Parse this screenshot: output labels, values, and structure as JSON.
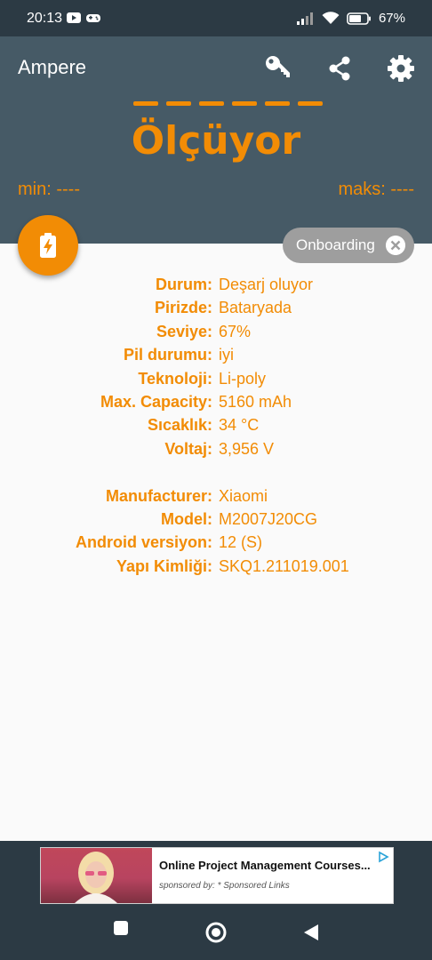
{
  "status_bar": {
    "time": "20:13",
    "battery_percent": "67%"
  },
  "app": {
    "title": "Ampere"
  },
  "header": {
    "measuring_text": "Ölçüyor",
    "min_label": "min: ----",
    "max_label": "maks: ----",
    "accent_color": "#f28c05",
    "background_color": "#465a66"
  },
  "onboarding_chip": {
    "label": "Onboarding"
  },
  "info": {
    "battery": [
      {
        "label": "Durum:",
        "value": "Deşarj oluyor"
      },
      {
        "label": "Pirizde:",
        "value": "Bataryada"
      },
      {
        "label": "Seviye:",
        "value": "67%"
      },
      {
        "label": "Pil durumu:",
        "value": "iyi"
      },
      {
        "label": "Teknoloji:",
        "value": "Li-poly"
      },
      {
        "label": "Max. Capacity:",
        "value": "5160 mAh"
      },
      {
        "label": "Sıcaklık:",
        "value": "34 °C"
      },
      {
        "label": "Voltaj:",
        "value": "3,956 V"
      }
    ],
    "device": [
      {
        "label": "Manufacturer:",
        "value": "Xiaomi"
      },
      {
        "label": "Model:",
        "value": "M2007J20CG"
      },
      {
        "label": "Android versiyon:",
        "value": "12 (S)"
      },
      {
        "label": "Yapı Kimliği:",
        "value": "SKQ1.211019.001"
      }
    ]
  },
  "ad": {
    "title": "Online Project Management Courses...",
    "subtitle": "sponsored by: * Sponsored Links"
  },
  "icons": {
    "key": "key-icon",
    "share": "share-icon",
    "settings": "gear-icon",
    "fab": "battery-charging-icon",
    "chip_close": "close-icon",
    "nav_recents": "square-icon",
    "nav_home": "circle-icon",
    "nav_back": "triangle-back-icon"
  }
}
